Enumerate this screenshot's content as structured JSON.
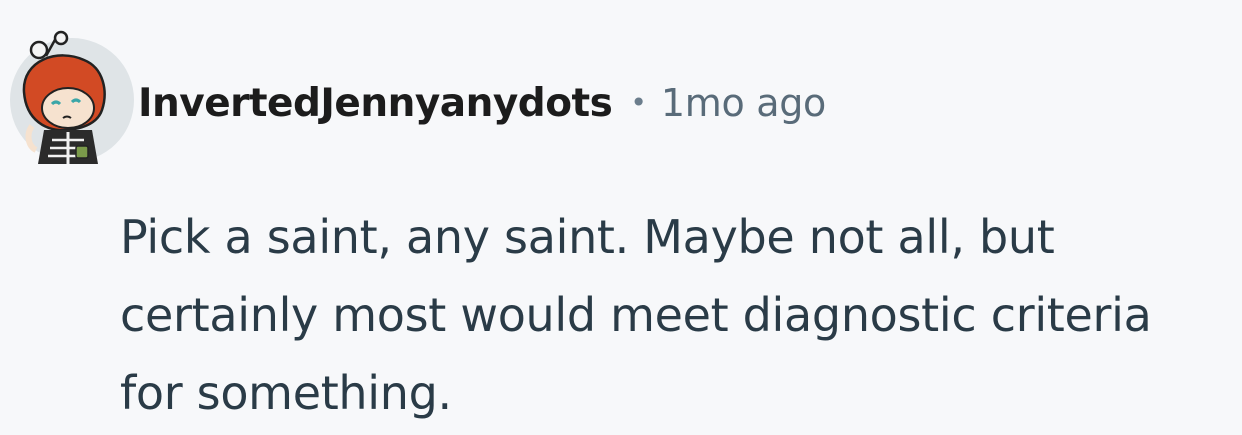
{
  "comment": {
    "author": "InvertedJennyanydots",
    "separator": "•",
    "timestamp": "1mo ago",
    "avatar_icon": "snoo-avatar-icon",
    "body_lines": [
      "Pick a saint, any saint. Maybe not all, but",
      "certainly most would meet diagnostic criteria",
      "for something."
    ]
  },
  "colors": {
    "background": "#f7f8fa",
    "username": "#1c1c1c",
    "timestamp": "#596b79",
    "body_text": "#2a3b47",
    "avatar_hair": "#d24a24",
    "avatar_bg": "#dfe4e7"
  }
}
